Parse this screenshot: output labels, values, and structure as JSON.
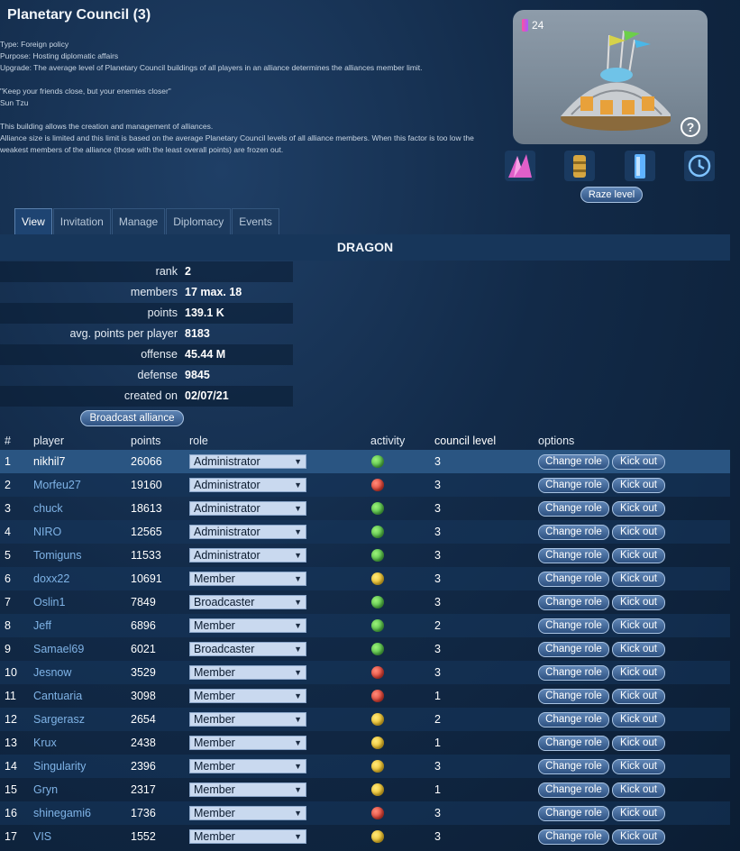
{
  "header": {
    "title": "Planetary Council (3)",
    "type_line": "Type: Foreign policy",
    "purpose_line": "Purpose: Hosting diplomatic affairs",
    "upgrade_line": "Upgrade: The average level of Planetary Council buildings of all players in an alliance determines the alliances member limit.",
    "quote": "\"Keep your friends close, but your enemies closer\"",
    "quote_author": "Sun Tzu",
    "info_1": "This building allows the creation and management of alliances.",
    "info_2": "Alliance size is limited and this limit is based on the average Planetary Council levels of all alliance members. When this factor is too low the weakest members of the alliance (those with the least overall points) are frozen out."
  },
  "building": {
    "level_badge": "24",
    "help_label": "?"
  },
  "resource_icons": [
    "crystal-icon",
    "fuel-barrel-icon",
    "energy-cell-icon",
    "clock-icon"
  ],
  "raze_label": "Raze level",
  "tabs": [
    {
      "label": "View",
      "active": true
    },
    {
      "label": "Invitation",
      "active": false
    },
    {
      "label": "Manage",
      "active": false
    },
    {
      "label": "Diplomacy",
      "active": false
    },
    {
      "label": "Events",
      "active": false
    }
  ],
  "alliance": {
    "name": "DRAGON",
    "stats": [
      {
        "label": "rank",
        "value": "2"
      },
      {
        "label": "members",
        "value": "17 max. 18"
      },
      {
        "label": "points",
        "value": "139.1 K"
      },
      {
        "label": "avg. points per player",
        "value": "8183"
      },
      {
        "label": "offense",
        "value": "45.44 M"
      },
      {
        "label": "defense",
        "value": "9845"
      },
      {
        "label": "created on",
        "value": "02/07/21"
      }
    ],
    "broadcast_label": "Broadcast alliance"
  },
  "members": {
    "headers": {
      "num": "#",
      "player": "player",
      "points": "points",
      "role": "role",
      "activity": "activity",
      "council": "council level",
      "options": "options"
    },
    "change_role_label": "Change role",
    "kick_label": "Kick out",
    "rows": [
      {
        "n": "1",
        "player": "nikhil7",
        "points": "26066",
        "role": "Administrator",
        "activity": "green",
        "council": "3"
      },
      {
        "n": "2",
        "player": "Morfeu27",
        "points": "19160",
        "role": "Administrator",
        "activity": "red",
        "council": "3"
      },
      {
        "n": "3",
        "player": "chuck",
        "points": "18613",
        "role": "Administrator",
        "activity": "green",
        "council": "3"
      },
      {
        "n": "4",
        "player": "NIRO",
        "points": "12565",
        "role": "Administrator",
        "activity": "green",
        "council": "3"
      },
      {
        "n": "5",
        "player": "Tomiguns",
        "points": "11533",
        "role": "Administrator",
        "activity": "green",
        "council": "3"
      },
      {
        "n": "6",
        "player": "doxx22",
        "points": "10691",
        "role": "Member",
        "activity": "yellow",
        "council": "3"
      },
      {
        "n": "7",
        "player": "Oslin1",
        "points": "7849",
        "role": "Broadcaster",
        "activity": "green",
        "council": "3"
      },
      {
        "n": "8",
        "player": "Jeff",
        "points": "6896",
        "role": "Member",
        "activity": "green",
        "council": "2"
      },
      {
        "n": "9",
        "player": "Samael69",
        "points": "6021",
        "role": "Broadcaster",
        "activity": "green",
        "council": "3"
      },
      {
        "n": "10",
        "player": "Jesnow",
        "points": "3529",
        "role": "Member",
        "activity": "red",
        "council": "3"
      },
      {
        "n": "11",
        "player": "Cantuaria",
        "points": "3098",
        "role": "Member",
        "activity": "red",
        "council": "1"
      },
      {
        "n": "12",
        "player": "Sargerasz",
        "points": "2654",
        "role": "Member",
        "activity": "yellow",
        "council": "2"
      },
      {
        "n": "13",
        "player": "Krux",
        "points": "2438",
        "role": "Member",
        "activity": "yellow",
        "council": "1"
      },
      {
        "n": "14",
        "player": "Singularity",
        "points": "2396",
        "role": "Member",
        "activity": "yellow",
        "council": "3"
      },
      {
        "n": "15",
        "player": "Gryn",
        "points": "2317",
        "role": "Member",
        "activity": "yellow",
        "council": "1"
      },
      {
        "n": "16",
        "player": "shinegami6",
        "points": "1736",
        "role": "Member",
        "activity": "red",
        "council": "3"
      },
      {
        "n": "17",
        "player": "VIS",
        "points": "1552",
        "role": "Member",
        "activity": "yellow",
        "council": "3"
      }
    ]
  }
}
